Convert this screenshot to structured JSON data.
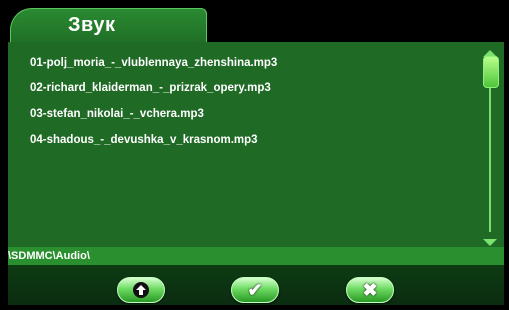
{
  "header": {
    "tab_label": "Звук"
  },
  "files": [
    "01-polj_moria_-_vlublennaya_zhenshina.mp3",
    "02-richard_klaiderman_-_prizrak_opery.mp3",
    "03-stefan_nikolai_-_vchera.mp3",
    "04-shadous_-_devushka_v_krasnom.mp3"
  ],
  "path": "\\SDMMC\\Audio\\",
  "toolbar": {
    "up_icon": "up-arrow-icon",
    "ok_icon": "checkmark-icon",
    "close_icon": "close-icon"
  },
  "colors": {
    "panel": "#1f6b25",
    "accent": "#7ae36f",
    "path_bar": "#2a8f2f"
  }
}
